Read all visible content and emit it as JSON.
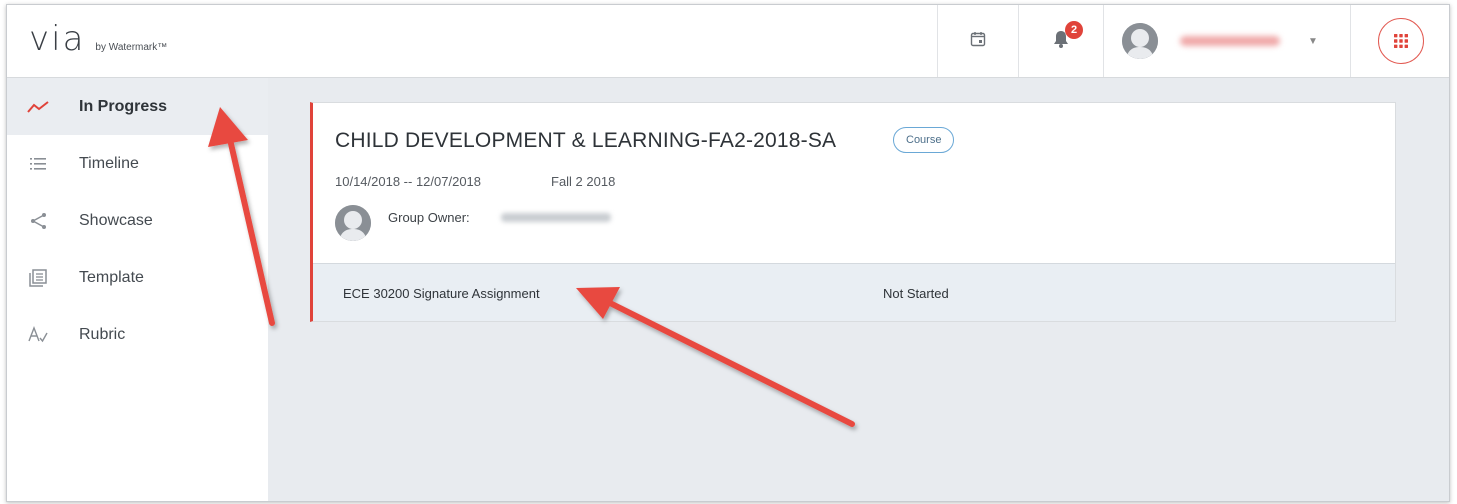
{
  "header": {
    "logo_main": "via",
    "logo_sub": "by Watermark™",
    "notifications_count": "2"
  },
  "sidebar": {
    "items": [
      {
        "label": "In Progress",
        "icon": "trend-line-icon",
        "active": true
      },
      {
        "label": "Timeline",
        "icon": "list-icon",
        "active": false
      },
      {
        "label": "Showcase",
        "icon": "share-icon",
        "active": false
      },
      {
        "label": "Template",
        "icon": "template-icon",
        "active": false
      },
      {
        "label": "Rubric",
        "icon": "rubric-icon",
        "active": false
      }
    ]
  },
  "card": {
    "title": "CHILD DEVELOPMENT & LEARNING-FA2-2018-SA",
    "type_badge": "Course",
    "dates": "10/14/2018 -- 12/07/2018",
    "term": "Fall 2 2018",
    "owner_label": "Group Owner:",
    "assignments": [
      {
        "name": "ECE 30200 Signature Assignment",
        "status": "Not Started"
      }
    ]
  },
  "colors": {
    "accent_red": "#e0433a",
    "pill_blue": "#6aa8d6",
    "background": "#e8ebef"
  }
}
